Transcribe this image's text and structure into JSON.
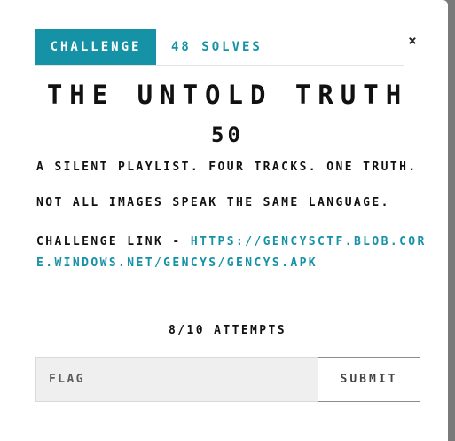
{
  "tabs": {
    "challenge": "CHALLENGE",
    "solves": "48 SOLVES"
  },
  "close_icon": "close-icon",
  "challenge": {
    "title": "THE UNTOLD TRUTH",
    "points": "50",
    "description_line_1": "A SILENT PLAYLIST. FOUR TRACKS. ONE TRUTH.",
    "description_line_2": "NOT ALL IMAGES SPEAK THE SAME LANGUAGE.",
    "link_label": "CHALLENGE LINK - ",
    "link_url": "HTTPS://GENCYSCTF.BLOB.CORE.WINDOWS.NET/GENCYS/GENCYS.APK",
    "attempts": "8/10 ATTEMPTS"
  },
  "form": {
    "flag_placeholder": "FLAG",
    "submit_label": "SUBMIT"
  },
  "colors": {
    "accent": "#1692a6",
    "overlay": "#7a7a7a"
  }
}
